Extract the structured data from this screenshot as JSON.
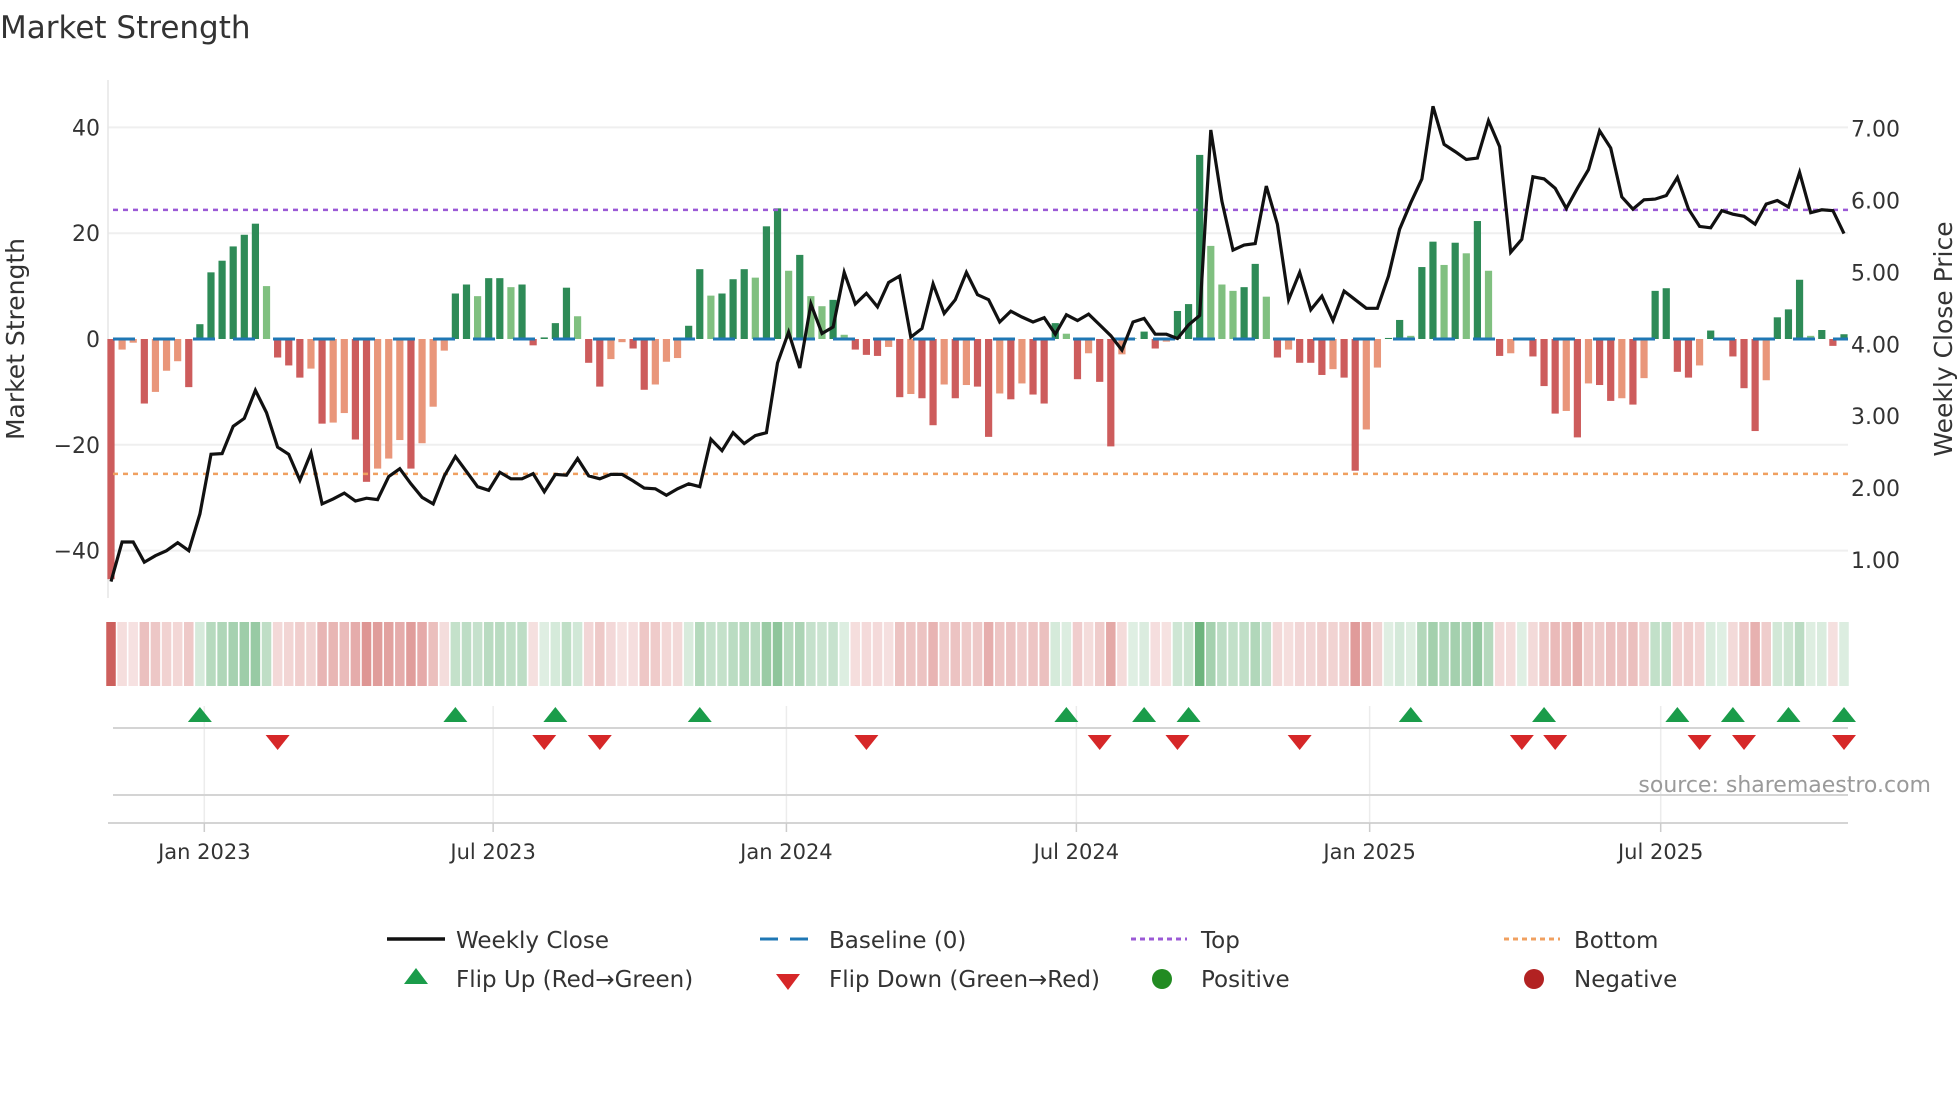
{
  "chart_data": {
    "type": "bar",
    "title": "Market Strength",
    "ylabel": "Market Strength",
    "y2label": "Weekly Close Price",
    "ylim": [
      -48,
      48
    ],
    "y2lim": [
      0.5,
      7.5
    ],
    "grid": true,
    "legend_placement": "bottom",
    "left_ticks": [
      {
        "v": -40,
        "label": "−40"
      },
      {
        "v": -20,
        "label": "−20"
      },
      {
        "v": 0,
        "label": "0"
      },
      {
        "v": 20,
        "label": "20"
      },
      {
        "v": 40,
        "label": "40"
      }
    ],
    "right_ticks": [
      {
        "v": 1,
        "label": "1.00"
      },
      {
        "v": 2,
        "label": "2.00"
      },
      {
        "v": 3,
        "label": "3.00"
      },
      {
        "v": 4,
        "label": "4.00"
      },
      {
        "v": 5,
        "label": "5.00"
      },
      {
        "v": 6,
        "label": "6.00"
      },
      {
        "v": 7,
        "label": "7.00"
      }
    ],
    "x_ticks": [
      {
        "week": 8.4,
        "label": "Jan 2023"
      },
      {
        "week": 34.4,
        "label": "Jul 2023"
      },
      {
        "week": 60.8,
        "label": "Jan 2024"
      },
      {
        "week": 86.9,
        "label": "Jul 2024"
      },
      {
        "week": 113.3,
        "label": "Jan 2025"
      },
      {
        "week": 139.5,
        "label": "Jul 2025"
      }
    ],
    "top_level": 24.4,
    "bottom_level": -25.5,
    "strength": [
      -45.4,
      -2,
      -0.7,
      -12.2,
      -10,
      -6,
      -4.2,
      -9.1,
      2.8,
      12.6,
      14.8,
      17.5,
      19.7,
      21.8,
      10,
      -3.5,
      -5,
      -7.3,
      -5.6,
      -16,
      -15.8,
      -14,
      -19,
      -27,
      -24.5,
      -22.6,
      -19.1,
      -24.5,
      -19.7,
      -12.8,
      -2.2,
      8.6,
      10.3,
      8.1,
      11.5,
      11.5,
      9.8,
      10.3,
      -1.2,
      0.3,
      3,
      9.7,
      4.3,
      -4.5,
      -9,
      -3.8,
      -0.6,
      -1.8,
      -9.6,
      -8.6,
      -4.3,
      -3.6,
      2.5,
      13.2,
      8.2,
      8.6,
      11.3,
      13.2,
      11.6,
      21.3,
      24.7,
      12.9,
      15.9,
      8.1,
      6.2,
      7.4,
      0.8,
      -2,
      -3,
      -3.2,
      -1.5,
      -11,
      -10.4,
      -11.2,
      -16.3,
      -8.6,
      -11.2,
      -8.7,
      -9,
      -18.5,
      -10.3,
      -11.4,
      -8.4,
      -10.5,
      -12.2,
      3,
      1,
      -7.6,
      -2.7,
      -8.1,
      -20.3,
      -2.9,
      0.1,
      1.4,
      -1.8,
      -0.5,
      5.3,
      6.6,
      34.8,
      17.6,
      10.3,
      9.1,
      9.8,
      14.2,
      8,
      -3.5,
      -2,
      -4.5,
      -4.5,
      -6.8,
      -5.7,
      -7.3,
      -24.9,
      -17.1,
      -5.4,
      0.2,
      3.6,
      0.6,
      13.6,
      18.4,
      14,
      18.2,
      16.2,
      22.3,
      12.9,
      -3.2,
      -2.7,
      0,
      -3.3,
      -8.9,
      -14.1,
      -13.6,
      -18.6,
      -8.4,
      -8.7,
      -11.7,
      -11.2,
      -12.4,
      -7.4,
      9.1,
      9.6,
      -6.2,
      -7.3,
      -5,
      1.6,
      0,
      -3.3,
      -9.3,
      -17.4,
      -7.8,
      4.1,
      5.6,
      11.2,
      0.6,
      1.7,
      -1.3,
      0.9
    ],
    "weekly_close": [
      0.7,
      1.25,
      1.25,
      0.97,
      1.06,
      1.13,
      1.24,
      1.13,
      1.64,
      2.47,
      2.48,
      2.86,
      2.97,
      3.36,
      3.05,
      2.57,
      2.47,
      2.11,
      2.49,
      1.78,
      1.85,
      1.93,
      1.82,
      1.86,
      1.84,
      2.16,
      2.27,
      2.06,
      1.87,
      1.78,
      2.17,
      2.44,
      2.23,
      2.02,
      1.97,
      2.22,
      2.13,
      2.13,
      2.2,
      1.95,
      2.19,
      2.18,
      2.41,
      2.17,
      2.13,
      2.19,
      2.19,
      2.1,
      2.0,
      1.99,
      1.9,
      1.99,
      2.06,
      2.02,
      2.68,
      2.52,
      2.77,
      2.62,
      2.73,
      2.77,
      3.74,
      4.17,
      3.67,
      4.56,
      4.15,
      4.24,
      5.0,
      4.56,
      4.71,
      4.52,
      4.86,
      4.95,
      4.1,
      4.22,
      4.84,
      4.43,
      4.62,
      5.0,
      4.69,
      4.62,
      4.31,
      4.46,
      4.38,
      4.31,
      4.37,
      4.14,
      4.41,
      4.33,
      4.42,
      4.27,
      4.12,
      3.92,
      4.31,
      4.36,
      4.14,
      4.14,
      4.08,
      4.27,
      4.4,
      6.98,
      5.99,
      5.31,
      5.38,
      5.4,
      6.2,
      5.67,
      4.62,
      5.0,
      4.48,
      4.67,
      4.33,
      4.74,
      4.62,
      4.5,
      4.5,
      4.95,
      5.6,
      5.97,
      6.3,
      7.31,
      6.78,
      6.68,
      6.57,
      6.59,
      7.11,
      6.75,
      5.28,
      5.46,
      6.33,
      6.3,
      6.17,
      5.89,
      6.17,
      6.43,
      6.97,
      6.73,
      6.05,
      5.88,
      6.01,
      6.02,
      6.07,
      6.32,
      5.88,
      5.64,
      5.62,
      5.86,
      5.81,
      5.78,
      5.67,
      5.95,
      6.0,
      5.91,
      6.39,
      5.83,
      5.87,
      5.86,
      5.54
    ],
    "flip_up_weeks": [
      8,
      31,
      40,
      53,
      86,
      93,
      97,
      117,
      129,
      141,
      146,
      151,
      156
    ],
    "flip_down_weeks": [
      15,
      39,
      44,
      68,
      89,
      96,
      107,
      127,
      130,
      143,
      147,
      156
    ]
  },
  "legend": {
    "weekly_close": "Weekly Close",
    "baseline": "Baseline (0)",
    "top": "Top",
    "bottom": "Bottom",
    "flip_up": "Flip Up (Red→Green)",
    "flip_down": "Flip Down (Green→Red)",
    "positive": "Positive",
    "negative": "Negative"
  },
  "source": "source: sharemaestro.com",
  "colors": {
    "pos_strong": "#2e8b57",
    "pos_weak": "#80c080",
    "neg_strong": "#cd5c5c",
    "neg_weak": "#e9967a",
    "baseline": "#1f77b4",
    "top": "#9b59d6",
    "bottom": "#f0a060",
    "flip_up": "#1a9c4a",
    "flip_down": "#d62728",
    "positive": "#228b22",
    "negative": "#b22222",
    "price": "#111111"
  }
}
